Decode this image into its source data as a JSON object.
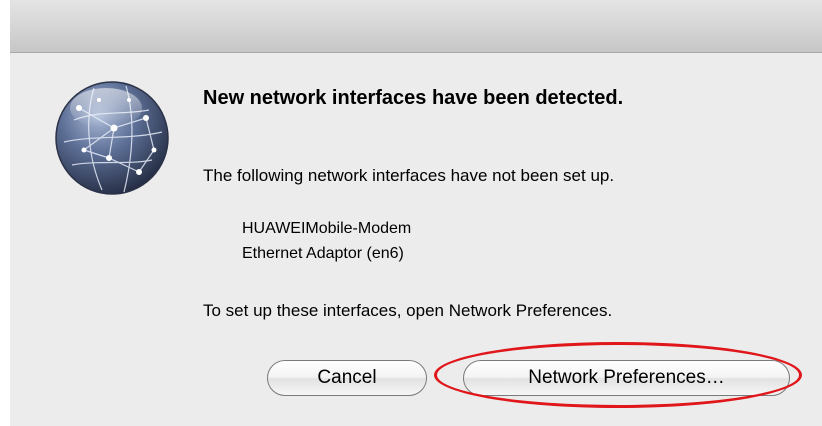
{
  "dialog": {
    "title": "New network interfaces have been detected.",
    "subtitle": "The following network interfaces have not been set up.",
    "interfaces": [
      "HUAWEIMobile-Modem",
      "Ethernet Adaptor (en6)"
    ],
    "instructions": "To set up these interfaces, open Network Preferences.",
    "icon": "network-globe-icon"
  },
  "buttons": {
    "cancel_label": "Cancel",
    "network_preferences_label": "Network Preferences…"
  },
  "annotation": {
    "highlight_color": "#e0161b",
    "highlight_target": "network-preferences-button"
  }
}
